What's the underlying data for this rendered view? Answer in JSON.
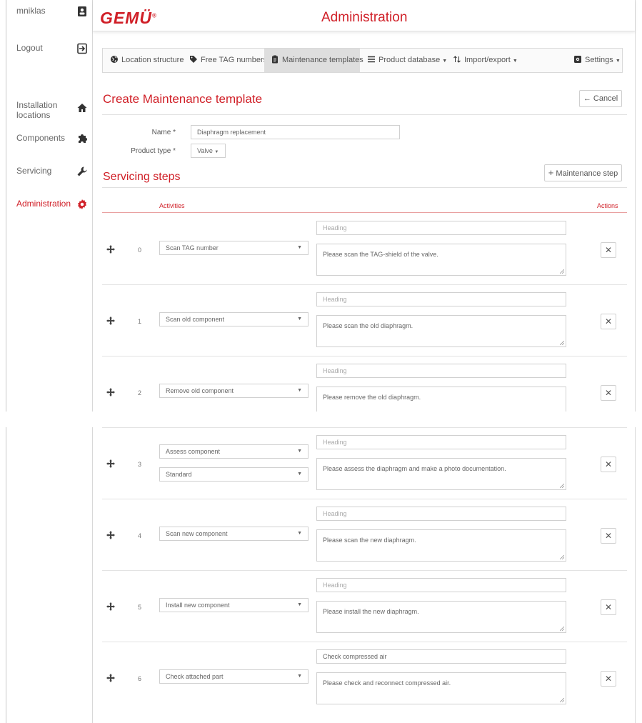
{
  "sidebar": {
    "user": "mniklas",
    "logout": "Logout",
    "items": [
      {
        "label": "Installation locations",
        "icon": "home-icon"
      },
      {
        "label": "Components",
        "icon": "puzzle-icon"
      },
      {
        "label": "Servicing",
        "icon": "wrench-icon"
      },
      {
        "label": "Administration",
        "icon": "gear-icon",
        "active": true
      }
    ]
  },
  "header": {
    "logo": "GEMÜ",
    "logo_mark": "®",
    "title": "Administration"
  },
  "tabs": [
    {
      "label": "Location structure",
      "icon": "globe-icon"
    },
    {
      "label": "Free TAG numbers",
      "icon": "tag-icon"
    },
    {
      "label": "Maintenance templates",
      "icon": "clipboard-icon",
      "active": true
    },
    {
      "label": "Product database",
      "icon": "list-icon",
      "dropdown": true
    },
    {
      "label": "Import/export",
      "icon": "sort-icon",
      "dropdown": true
    },
    {
      "label": "Settings",
      "icon": "settings-icon",
      "dropdown": true
    }
  ],
  "page": {
    "title": "Create Maintenance template",
    "cancel": "Cancel"
  },
  "form": {
    "name_label": "Name *",
    "name_value": "Diaphragm replacement",
    "ptype_label": "Product type *",
    "ptype_value": "Valve"
  },
  "steps_section": {
    "title": "Servicing steps",
    "add_button": "Maintenance step",
    "col_activities": "Activities",
    "col_actions": "Actions"
  },
  "heading_placeholder": "Heading",
  "rows": [
    {
      "num": "0",
      "activity": "Scan TAG number",
      "heading": "",
      "desc": "Please scan the TAG-shield of the valve."
    },
    {
      "num": "1",
      "activity": "Scan old component",
      "heading": "",
      "desc": "Please scan the old diaphragm."
    },
    {
      "num": "2",
      "activity": "Remove old component",
      "heading": "",
      "desc": "Please remove the old diaphragm."
    },
    {
      "num": "3",
      "activity": "Assess component",
      "activity2": "Standard",
      "heading": "",
      "desc": "Please assess the diaphragm and make a photo documentation."
    },
    {
      "num": "4",
      "activity": "Scan new component",
      "heading": "",
      "desc": "Please scan the new diaphragm."
    },
    {
      "num": "5",
      "activity": "Install new component",
      "heading": "",
      "desc": "Please install the new diaphragm."
    },
    {
      "num": "6",
      "activity": "Check attached part",
      "heading": "Check compressed air",
      "desc": "Please check and reconnect compressed air."
    }
  ],
  "colors": {
    "accent": "#d01f27",
    "border": "#d0d0d0"
  }
}
